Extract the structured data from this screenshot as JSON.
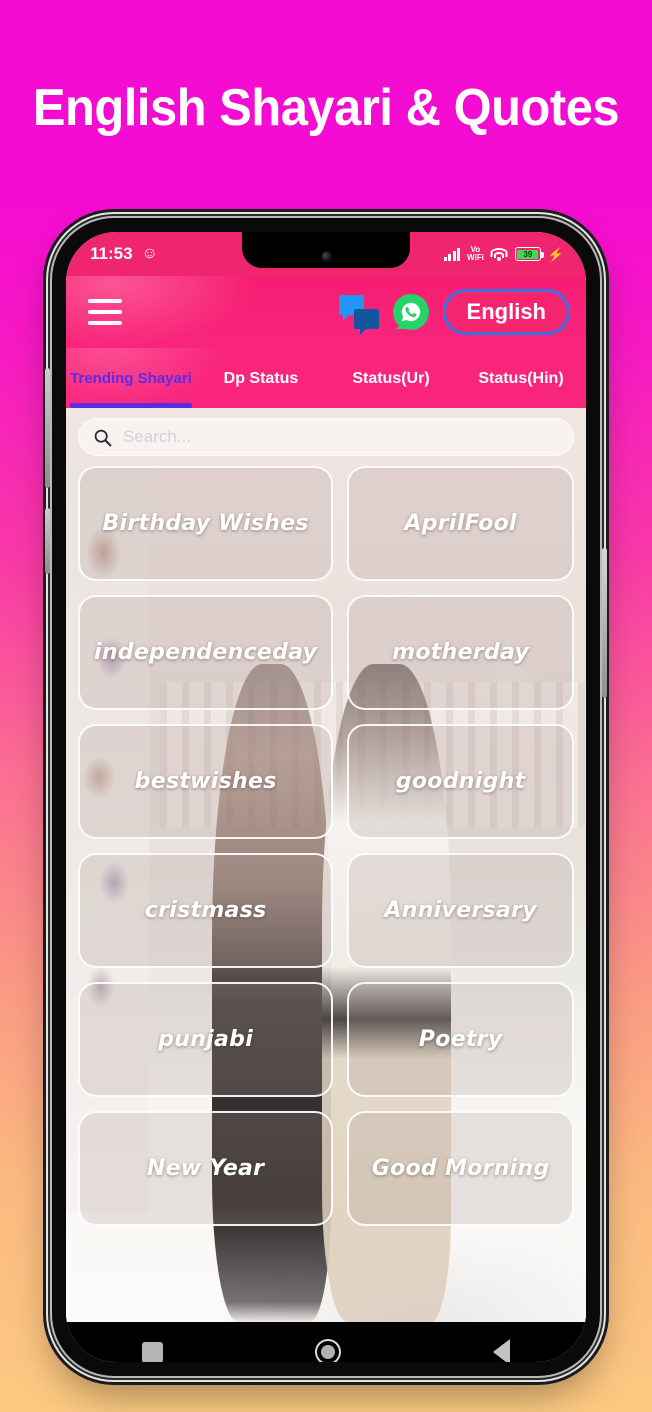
{
  "page": {
    "headline": "English Shayari & Quotes",
    "bg_top_color": "#f50cd2",
    "bg_bottom_color": "#fbc981"
  },
  "statusbar": {
    "time": "11:53",
    "clock_icon": "smiley-face-icon",
    "signal_icon": "cellular-signal-icon",
    "vowifi_line1": "Vo",
    "vowifi_line2": "WiFi",
    "wifi_icon": "wifi-icon",
    "battery_level": "39",
    "battery_color": "#3ddc4a",
    "charging_icon": "⚡"
  },
  "appbar": {
    "menu_icon": "hamburger-menu-icon",
    "chat_icon": "chat-bubbles-icon",
    "whatsapp_icon": "whatsapp-icon",
    "language_button": "English",
    "language_border_color": "#3f6fe0",
    "bar_color": "#f9257c"
  },
  "tabs": {
    "active_index": 0,
    "active_color": "#5b2be8",
    "items": [
      {
        "label": "Trending Shayari"
      },
      {
        "label": "Dp Status"
      },
      {
        "label": "Status(Ur)"
      },
      {
        "label": "Status(Hin)"
      }
    ]
  },
  "search": {
    "icon": "search-icon",
    "placeholder": "Search...",
    "value": ""
  },
  "grid": {
    "items": [
      {
        "label": "Birthday Wishes"
      },
      {
        "label": "AprilFool"
      },
      {
        "label": "independenceday"
      },
      {
        "label": "motherday"
      },
      {
        "label": "bestwishes"
      },
      {
        "label": "goodnight"
      },
      {
        "label": "cristmass"
      },
      {
        "label": "Anniversary"
      },
      {
        "label": "punjabi"
      },
      {
        "label": "Poetry"
      },
      {
        "label": "New Year"
      },
      {
        "label": "Good Morning"
      }
    ]
  },
  "navbar": {
    "recents_icon": "square-recents-icon",
    "home_icon": "circle-home-icon",
    "back_icon": "triangle-back-icon"
  }
}
